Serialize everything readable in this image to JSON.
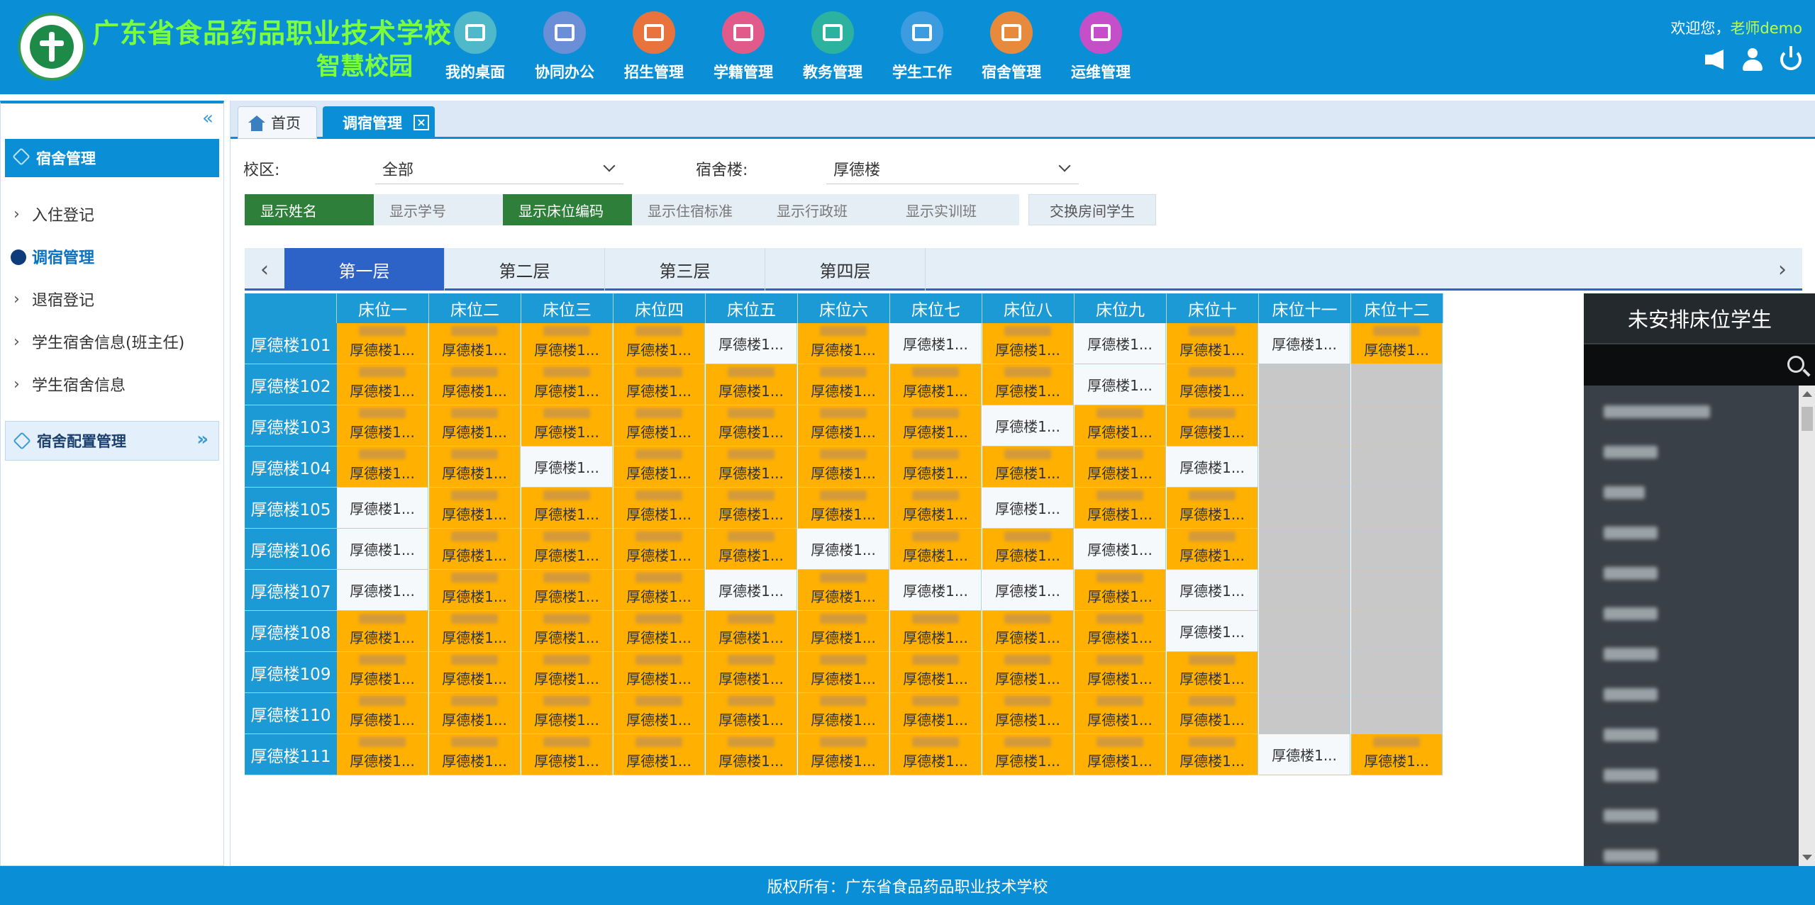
{
  "header": {
    "school_name": "广东省食品药品职业技术学校",
    "campus_name": "智慧校园",
    "welcome_prefix": "欢迎您，",
    "username": "老师demo",
    "nav": [
      {
        "label": "我的桌面",
        "color": "#4fb8c9",
        "icon": "desktop-icon"
      },
      {
        "label": "协同办公",
        "color": "#6a8fd6",
        "icon": "office-icon"
      },
      {
        "label": "招生管理",
        "color": "#e8733c",
        "icon": "enroll-icon"
      },
      {
        "label": "学籍管理",
        "color": "#e05a8a",
        "icon": "printer-icon"
      },
      {
        "label": "教务管理",
        "color": "#2bb3a0",
        "icon": "teaching-icon"
      },
      {
        "label": "学生工作",
        "color": "#3d9be0",
        "icon": "student-work-icon"
      },
      {
        "label": "宿舍管理",
        "color": "#e88a3c",
        "icon": "dorm-icon"
      },
      {
        "label": "运维管理",
        "color": "#c44fc9",
        "icon": "tools-icon"
      }
    ]
  },
  "sidebar": {
    "head": "宿舍管理",
    "items": [
      {
        "label": "入住登记",
        "active": false
      },
      {
        "label": "调宿管理",
        "active": true
      },
      {
        "label": "退宿登记",
        "active": false
      },
      {
        "label": "学生宿舍信息(班主任)",
        "active": false
      },
      {
        "label": "学生宿舍信息",
        "active": false
      }
    ],
    "group": "宿舍配置管理"
  },
  "tabs": {
    "home": "首页",
    "active": "调宿管理",
    "close": "×"
  },
  "filters": {
    "campus_label": "校区:",
    "campus_value": "全部",
    "building_label": "宿舍楼:",
    "building_value": "厚德楼"
  },
  "toggles": [
    {
      "label": "显示姓名",
      "on": true
    },
    {
      "label": "显示学号",
      "on": false
    },
    {
      "label": "显示床位编码",
      "on": true
    },
    {
      "label": "显示住宿标准",
      "on": false
    },
    {
      "label": "显示行政班",
      "on": false
    },
    {
      "label": "显示实训班",
      "on": false
    }
  ],
  "swap_button": "交换房间学生",
  "floors": {
    "prev": "‹",
    "next": "›",
    "tabs": [
      "第一层",
      "第二层",
      "第三层",
      "第四层"
    ],
    "active_index": 0
  },
  "grid": {
    "bed_headers": [
      "床位一",
      "床位二",
      "床位三",
      "床位四",
      "床位五",
      "床位六",
      "床位七",
      "床位八",
      "床位九",
      "床位十",
      "床位十一",
      "床位十二"
    ],
    "cell_text": "厚德楼1...",
    "rooms": [
      {
        "name": "厚德楼101",
        "beds": "OOOOEOEOEOEO"
      },
      {
        "name": "厚德楼102",
        "beds": "OOOOOOOOEONN"
      },
      {
        "name": "厚德楼103",
        "beds": "OOOOOOOEOONN"
      },
      {
        "name": "厚德楼104",
        "beds": "OOEOOOOOOENN"
      },
      {
        "name": "厚德楼105",
        "beds": "EOOOOOOEOONN"
      },
      {
        "name": "厚德楼106",
        "beds": "EOOOOEOOEONN"
      },
      {
        "name": "厚德楼107",
        "beds": "EOOOEOEEOENN"
      },
      {
        "name": "厚德楼108",
        "beds": "OOOOOOOOOENN"
      },
      {
        "name": "厚德楼109",
        "beds": "OOOOOOOOOONN"
      },
      {
        "name": "厚德楼110",
        "beds": "OOOOOOOOOONN"
      },
      {
        "name": "厚德楼111",
        "beds": "OOOOOOOOOOEO"
      }
    ]
  },
  "panel": {
    "title": "未安排床位学生",
    "student_count": 12
  },
  "footer": "版权所有：广东省食品药品职业技术学校"
}
